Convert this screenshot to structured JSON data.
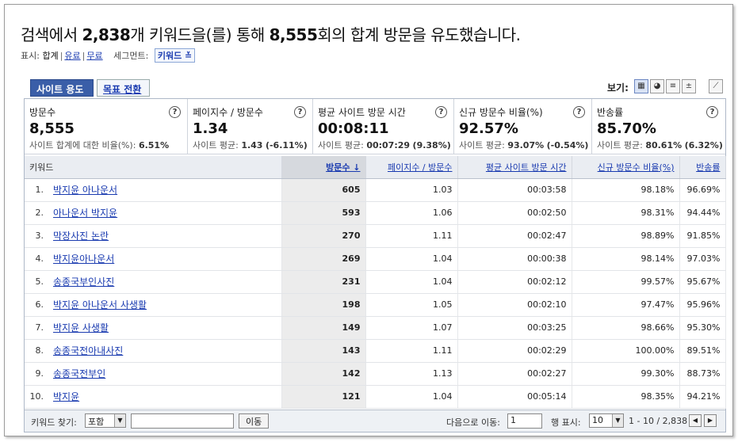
{
  "heading": {
    "p1": "검색에서 ",
    "kw_count": "2,838",
    "p2": "개 키워드을(를) 통해 ",
    "visits": "8,555",
    "p3": "회의 합계 방문을 유도했습니다."
  },
  "subline": {
    "show_label": "표시:",
    "total": "합계",
    "paid": "유료",
    "free": "무료",
    "segment_label": "세그먼트:",
    "segment_value": "키워드"
  },
  "tabs": {
    "site_usage": "사이트 용도",
    "goal_conversion": "목표 전환"
  },
  "view": {
    "label": "보기:"
  },
  "metrics": [
    {
      "name": "방문수",
      "value": "8,555",
      "sub_label": "사이트 합계에 대한 비율(%):",
      "sub_value": "6.51%",
      "sub_delta": ""
    },
    {
      "name": "페이지수 / 방문수",
      "value": "1.34",
      "sub_label": "사이트 평균:",
      "sub_value": "1.43",
      "sub_delta": "(-6.11%)"
    },
    {
      "name": "평균 사이트 방문 시간",
      "value": "00:08:11",
      "sub_label": "사이트 평균:",
      "sub_value": "00:07:29",
      "sub_delta": "(9.38%)"
    },
    {
      "name": "신규 방문수 비율(%)",
      "value": "92.57%",
      "sub_label": "사이트 평균:",
      "sub_value": "93.07%",
      "sub_delta": "(-0.54%)"
    },
    {
      "name": "반송률",
      "value": "85.70%",
      "sub_label": "사이트 평균:",
      "sub_value": "80.61%",
      "sub_delta": "(6.32%)"
    }
  ],
  "help_glyph": "?",
  "table": {
    "headers": [
      "키워드",
      "방문수 ↓",
      "페이지수 / 방문수",
      "평균 사이트 방문 시간",
      "신규 방문수 비율(%)",
      "반송률"
    ],
    "rows": [
      [
        "1.",
        "박지윤 아나운서",
        "605",
        "1.03",
        "00:03:58",
        "98.18%",
        "96.69%"
      ],
      [
        "2.",
        "아나운서 박지윤",
        "593",
        "1.06",
        "00:02:50",
        "98.31%",
        "94.44%"
      ],
      [
        "3.",
        "막장사진 논란",
        "270",
        "1.11",
        "00:02:47",
        "98.89%",
        "91.85%"
      ],
      [
        "4.",
        "박지윤아나운서",
        "269",
        "1.04",
        "00:00:38",
        "98.14%",
        "97.03%"
      ],
      [
        "5.",
        "송종국부인사진",
        "231",
        "1.04",
        "00:02:12",
        "99.57%",
        "95.67%"
      ],
      [
        "6.",
        "박지윤 아나운서 사생활",
        "198",
        "1.05",
        "00:02:10",
        "97.47%",
        "95.96%"
      ],
      [
        "7.",
        "박지윤 사생활",
        "149",
        "1.07",
        "00:03:25",
        "98.66%",
        "95.30%"
      ],
      [
        "8.",
        "송종국전아내사진",
        "143",
        "1.11",
        "00:02:29",
        "100.00%",
        "89.51%"
      ],
      [
        "9.",
        "송종국전부인",
        "142",
        "1.13",
        "00:02:27",
        "99.30%",
        "88.73%"
      ],
      [
        "10.",
        "박지윤",
        "121",
        "1.04",
        "00:05:14",
        "98.35%",
        "94.21%"
      ]
    ]
  },
  "footer": {
    "find_label": "키워드 찾기:",
    "match_option": "포함",
    "go_button": "이동",
    "goto_label": "다음으로 이동:",
    "goto_value": "1",
    "rows_label": "행 표시:",
    "rows_value": "10",
    "range": "1 - 10 / 2,838"
  }
}
